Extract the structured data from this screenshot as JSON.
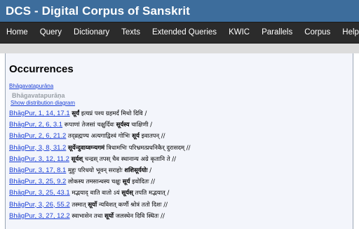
{
  "site_title": "DCS - Digital Corpus of Sanskrit",
  "nav": [
    "Home",
    "Query",
    "Dictionary",
    "Texts",
    "Extended Queries",
    "KWIC",
    "Parallels",
    "Corpus",
    "Help"
  ],
  "page_title": "Occurrences",
  "breadcrumb": "Bhāgavatapurāṇa",
  "section_heading": "Bhāgavatapurāṇa",
  "distribution_link": "Show distribution diagram",
  "occurrences": [
    {
      "ref": "BhāgPur, 1, 14, 17.1",
      "pre": "",
      "hit": "सूर्यं",
      "post": " इत्यप्रं पश्य ग्रहमर्दं मिथो दिवि /"
    },
    {
      "ref": "BhāgPur, 2, 6, 3.1",
      "pre": "रूपाणां तेजसां चक्षुर्दिवः ",
      "hit": "सूर्यस्य",
      "post": " चाक्षिणी /"
    },
    {
      "ref": "BhāgPur, 2, 6, 21.2",
      "pre": "तद्व्रह्मण्य अत्यगाद्विश्वं गोभिः ",
      "hit": "सूर्य",
      "post": " इवातपन् //"
    },
    {
      "ref": "BhāgPur, 3, 8, 31.2",
      "pre": "",
      "hit": "सूर्येन्दुवाय्वग्न्यगमं",
      "post": " त्रिधामभिः परिभ्रमत्प्रधनिकैर् दुरासदम् //"
    },
    {
      "ref": "BhāgPur, 3, 12, 11.2",
      "pre": "",
      "hit": "सूर्यश्",
      "post": " चन्द्रस् तपस् चैव स्थानान्य अग्रे कृतानि ते //"
    },
    {
      "ref": "BhāgPur, 3, 17, 8.1",
      "pre": "मुहुः परिधयो भूवन् सराहोः ",
      "hit": "शशिसूर्ययोः",
      "post": " /"
    },
    {
      "ref": "BhāgPur, 3, 25, 9.2",
      "pre": "लोकस्य तमसान्धस्य चक्षुः ",
      "hit": "सूर्य",
      "post": " इवोदितः //"
    },
    {
      "ref": "BhāgPur, 3, 25, 43.1",
      "pre": "मद्भयाद् वाति वातो ऽयं ",
      "hit": "सूर्यस्",
      "post": " तपति मद्भयात् /"
    },
    {
      "ref": "BhāgPur, 3, 26, 55.2",
      "pre": "तस्मात् ",
      "hit": "सूर्यो",
      "post": " न्यविशत् कर्णौ श्रोत्रं ततो दिशः //"
    },
    {
      "ref": "BhāgPur, 3, 27, 12.2",
      "pre": "स्वाभासेन तथा ",
      "hit": "सूर्यो",
      "post": " जलस्थेन दिवि स्थितः //"
    }
  ]
}
